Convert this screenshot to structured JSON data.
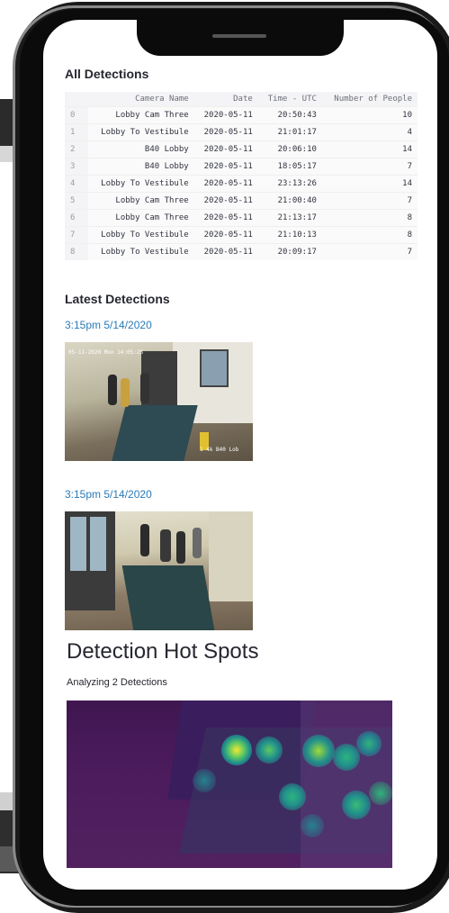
{
  "app": {
    "sections": {
      "all_detections": "All Detections",
      "latest_detections": "Latest Detections",
      "hot_spots": "Detection Hot Spots",
      "analyzing": "Analyzing 2 Detections"
    },
    "table": {
      "columns": [
        "",
        "Camera Name",
        "Date",
        "Time - UTC",
        "Number of People"
      ],
      "rows": [
        [
          "0",
          "Lobby Cam Three",
          "2020-05-11",
          "20:50:43",
          "10"
        ],
        [
          "1",
          "Lobby To Vestibule",
          "2020-05-11",
          "21:01:17",
          "4"
        ],
        [
          "2",
          "B40 Lobby",
          "2020-05-11",
          "20:06:10",
          "14"
        ],
        [
          "3",
          "B40 Lobby",
          "2020-05-11",
          "18:05:17",
          "7"
        ],
        [
          "4",
          "Lobby To Vestibule",
          "2020-05-11",
          "23:13:26",
          "14"
        ],
        [
          "5",
          "Lobby Cam Three",
          "2020-05-11",
          "21:00:40",
          "7"
        ],
        [
          "6",
          "Lobby Cam Three",
          "2020-05-11",
          "21:13:17",
          "8"
        ],
        [
          "7",
          "Lobby To Vestibule",
          "2020-05-11",
          "21:10:13",
          "8"
        ],
        [
          "8",
          "Lobby To Vestibule",
          "2020-05-11",
          "20:09:17",
          "7"
        ]
      ]
    },
    "latest": [
      {
        "timestamp": "3:15pm 5/14/2020",
        "overlay": "05-11-2020 Mon 14:05:25",
        "corner": "1 4k B40 Lob"
      },
      {
        "timestamp": "3:15pm 5/14/2020",
        "overlay": "",
        "corner": ""
      }
    ],
    "colors": {
      "link": "#2a7ab7",
      "heatmap_bg": "#4b1b5c",
      "heatmap_hot": "#f4e832"
    }
  }
}
